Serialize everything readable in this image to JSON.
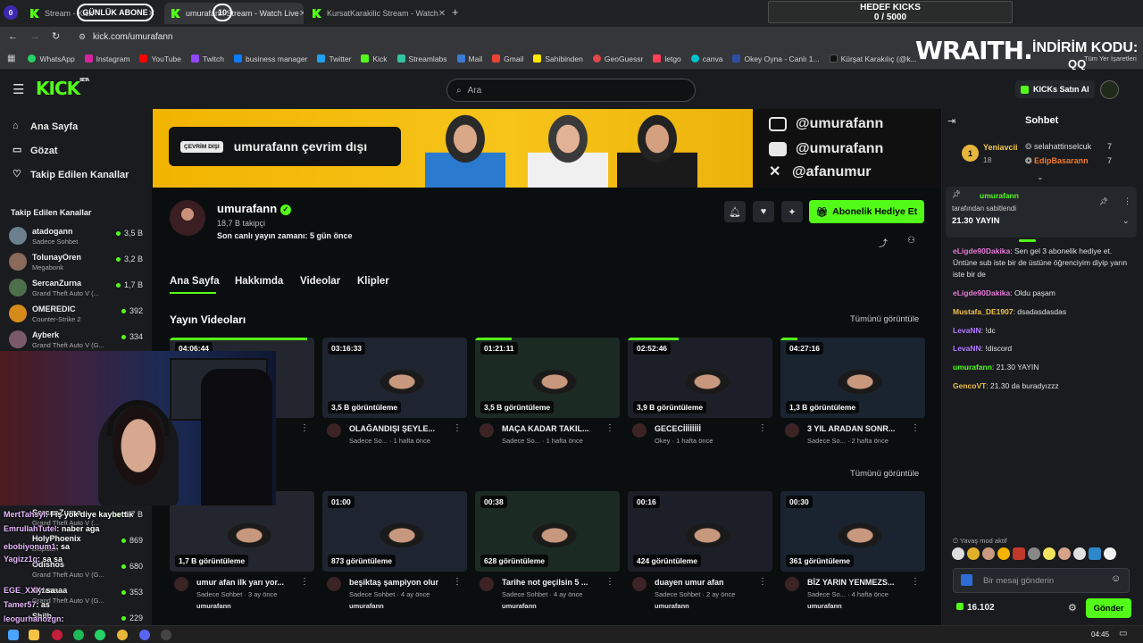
{
  "browser": {
    "tabs": [
      {
        "label": "Stream - Kick",
        "overlay": "GÜNLÜK ABONE"
      },
      {
        "label": "umurafann Stream - Watch Live",
        "overlay": "10"
      },
      {
        "label": "KursatKarakilic Stream - Watch"
      }
    ],
    "url": "kick.com/umurafann",
    "bookmarks": [
      "WhatsApp",
      "Instagram",
      "YouTube",
      "Twitch",
      "business manager",
      "Twitter",
      "Kick",
      "Streamlabs",
      "Mail",
      "Gmail",
      "Sahibinden",
      "GeoGuessr",
      "letgo",
      "canva",
      "Okey Oyna - Canlı 1...",
      "Kürşat Karakılıç (@k...",
      "Tüm Yer İşaretleri"
    ]
  },
  "stream_overlay": {
    "goal_title": "HEDEF KICKS",
    "goal_value": "0 / 5000",
    "sponsor": "WRAITH.",
    "discount_label": "İNDİRİM KODU:",
    "discount_code": "QQ",
    "badge_count": "0"
  },
  "kick": {
    "logo": "KICK",
    "logo_beta": "BETA",
    "search_placeholder": "Ara",
    "buy_kicks": "KICKs Satın Al",
    "nav": [
      "Ana Sayfa",
      "Gözat",
      "Takip Edilen Kanallar"
    ],
    "followed_title": "Takip Edilen Kanallar",
    "followed": [
      {
        "name": "atadogann",
        "game": "Sadece Sohbet",
        "viewers": "3,5 B",
        "color": "#6b7f8e"
      },
      {
        "name": "TolunayOren",
        "game": "Megabonk",
        "viewers": "3,2 B",
        "color": "#8a6a5a"
      },
      {
        "name": "SercanZurna",
        "game": "Grand Theft Auto V (...",
        "viewers": "1,7 B",
        "color": "#4e6f4b"
      },
      {
        "name": "OMEREDIC",
        "game": "Counter-Strike 2",
        "viewers": "392",
        "color": "#d68a1a"
      },
      {
        "name": "Ayberk",
        "game": "Grand Theft Auto V (G...",
        "viewers": "334",
        "color": "#7a5a6a"
      }
    ],
    "followed_lower": [
      {
        "name": "SercanZurna",
        "game": "Grand Theft Auto V (...",
        "viewers": "1,7 B"
      },
      {
        "name": "HolyPhoenix",
        "game": "Dispatch",
        "viewers": "869"
      },
      {
        "name": "Odishos",
        "game": "Grand Theft Auto V (G...",
        "viewers": "680"
      },
      {
        "name": "Aytaaaaa",
        "game": "Grand Theft Auto V (G...",
        "viewers": "353"
      },
      {
        "name": "Shilb",
        "game": "",
        "viewers": "229"
      }
    ]
  },
  "channel": {
    "offline_pill": "ÇEVRİM DIŞI",
    "offline_text": "umurafann çevrim dışı",
    "socials": [
      "@umurafann",
      "@umurafann",
      "@afanumur"
    ],
    "name": "umurafann",
    "followers": "18,7 B takipçi",
    "last_live": "Son canlı yayın zamanı: 5 gün önce",
    "gift_sub": "Abonelik Hediye Et",
    "tabs": [
      "Ana Sayfa",
      "Hakkımda",
      "Videolar",
      "Klipler"
    ],
    "section_videos": "Yayın Videoları",
    "see_all": "Tümünü görüntüle",
    "see_all_2": "Tümünü görüntüle"
  },
  "videos": [
    {
      "duration": "04:06:44",
      "views": "",
      "title": "",
      "meta": "nce",
      "progress": 0.95
    },
    {
      "duration": "03:16:33",
      "views": "3,5 B görüntüleme",
      "title": "OLAĞANDIŞI ŞEYLE...",
      "meta": "Sadece So... · 1 hafta önce",
      "progress": 0.0
    },
    {
      "duration": "01:21:11",
      "views": "3,5 B görüntüleme",
      "title": "MAÇA KADAR TAKIL...",
      "meta": "Sadece So... · 1 hafta önce",
      "progress": 0.25
    },
    {
      "duration": "02:52:46",
      "views": "3,9 B görüntüleme",
      "title": "GECECİİİİİİİİ",
      "meta": "Okey · 1 hafta önce",
      "progress": 0.35
    },
    {
      "duration": "04:27:16",
      "views": "1,3 B görüntüleme",
      "title": "3 YIL ARADAN SONR...",
      "meta": "Sadece So... · 2 hafta önce",
      "progress": 0.12
    }
  ],
  "clips": [
    {
      "duration": "",
      "views": "1,7 B görüntüleme",
      "title": "umur afan ilk yarı yor...",
      "meta": "Sadece Sohbet · 3 ay önce",
      "channel": "umurafann"
    },
    {
      "duration": "01:00",
      "views": "873 görüntüleme",
      "title": "beşiktaş şampiyon olur",
      "meta": "Sadece Sohbet · 4 ay önce",
      "channel": "umurafann"
    },
    {
      "duration": "00:38",
      "views": "628 görüntüleme",
      "title": "Tarihe not geçilsin 5 ...",
      "meta": "Sadece Sohbet · 4 ay önce",
      "channel": "umurafann"
    },
    {
      "duration": "00:16",
      "views": "424 görüntüleme",
      "title": "duayen umur afan",
      "meta": "Sadece Sohbet · 2 ay önce",
      "channel": "umurafann"
    },
    {
      "duration": "00:30",
      "views": "361 görüntüleme",
      "title": "BİZ YARIN YENMEZS...",
      "meta": "Sadece So... · 4 hafta önce",
      "channel": "umurafann"
    }
  ],
  "chat": {
    "title": "Sohbet",
    "top_gifter": {
      "rank": "1",
      "name": "Yeniavcii",
      "count": "18"
    },
    "gifters": [
      {
        "name": "selahattinselcuk",
        "count": "7"
      },
      {
        "name": "EdipBasarann",
        "count": "7"
      }
    ],
    "pinned_by": "umurafann",
    "pinned_label": "tarafından sabitlendi",
    "pinned_text": "21.30 YAYIN",
    "messages": [
      {
        "user": "eLigde90Dakika",
        "text": "Sen gel 3 abonelik hediye et. Üntüne sub iste bir de üstüne öğrenciyim diyip yarın iste bir de",
        "color": "#e67ad6"
      },
      {
        "user": "eLigde90Dakika",
        "text": "Oldu paşam",
        "color": "#e67ad6"
      },
      {
        "user": "Mustafa_DE1907",
        "text": "dsadasdasdas",
        "color": "#f0c04a"
      },
      {
        "user": "LevaNN",
        "text": "!dc",
        "color": "#b07bff"
      },
      {
        "user": "LevaNN",
        "text": "!discord",
        "color": "#b07bff"
      },
      {
        "user": "umurafann",
        "text": "21.30 YAYIN",
        "color": "#53fc18"
      },
      {
        "user": "GencoVT",
        "text": "21.30 da buradyızzz",
        "color": "#f0c04a"
      }
    ],
    "slow_mode": "Yavaş mod aktif",
    "input_placeholder": "Bir mesaj gönderin",
    "balance": "16.102",
    "send": "Gönder"
  },
  "overlay_chat": [
    {
      "user": "MertTahsyl",
      "text": "Fiş yok diye kaybettik"
    },
    {
      "user": "EmrullahTutel",
      "text": "naber aga"
    },
    {
      "user": "ebobiyonum1",
      "text": "sa"
    },
    {
      "user": "Yagizz1g",
      "text": "sa sa"
    },
    {
      "user": "EGE_XXX",
      "text": "sa"
    },
    {
      "user": "Tamer57",
      "text": "as"
    },
    {
      "user": "leogurhanozgn",
      "text": ""
    }
  ],
  "taskbar": {
    "time": "04:45"
  }
}
